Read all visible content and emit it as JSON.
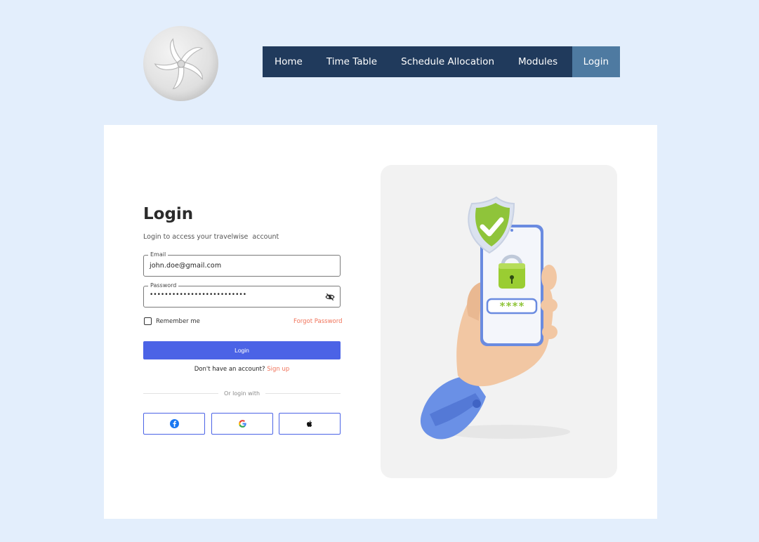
{
  "nav": {
    "items": [
      {
        "label": "Home"
      },
      {
        "label": "Time Table"
      },
      {
        "label": "Schedule Allocation"
      },
      {
        "label": "Modules"
      },
      {
        "label": "Login"
      }
    ]
  },
  "login": {
    "title": "Login",
    "subtitle": "Login to access your travelwise  account",
    "email": {
      "label": "Email",
      "value": "john.doe@gmail.com"
    },
    "password": {
      "label": "Password",
      "value": "••••••••••••••••••••••••••"
    },
    "remember_label": "Remember me",
    "forgot_label": "Forgot Password",
    "button_label": "Login",
    "signup_prompt": "Don't have an account?",
    "signup_link": "Sign up",
    "divider_text": "Or login with"
  },
  "social": [
    {
      "icon": "facebook-icon"
    },
    {
      "icon": "google-icon"
    },
    {
      "icon": "apple-icon"
    }
  ],
  "illustration": {
    "pin_mask": "****"
  },
  "colors": {
    "background": "#e3eefc",
    "nav": "#203a5c",
    "nav_active": "#4e7aa1",
    "primary": "#4b63e6",
    "accent": "#f0735a"
  }
}
